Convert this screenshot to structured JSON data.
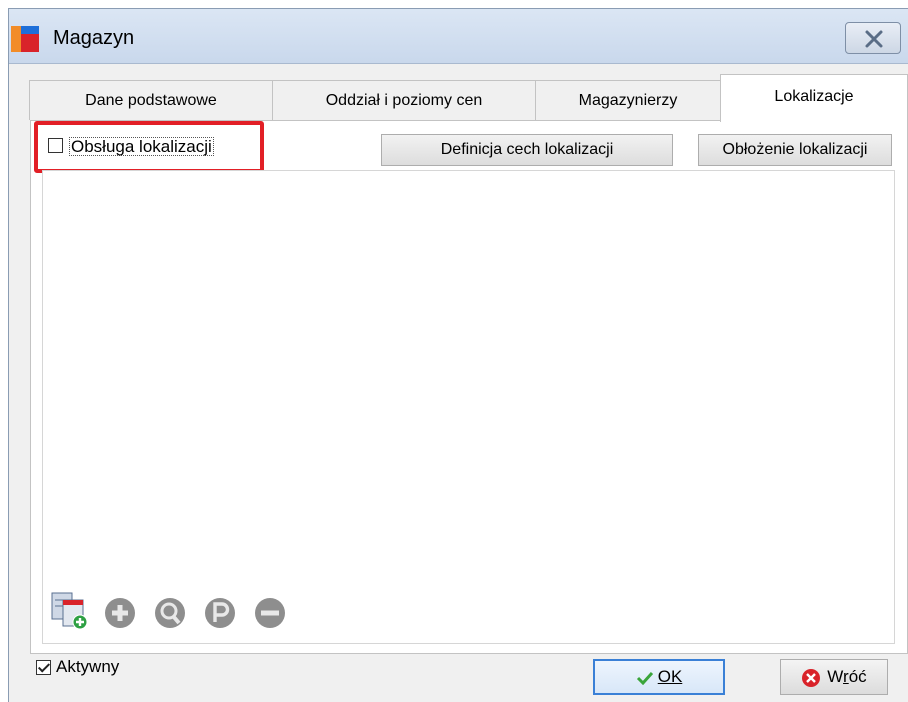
{
  "window": {
    "title": "Magazyn"
  },
  "tabs": [
    {
      "label": "Dane podstawowe"
    },
    {
      "label": "Oddział i poziomy cen"
    },
    {
      "label": "Magazynierzy"
    },
    {
      "label": "Lokalizacje",
      "active": true
    }
  ],
  "lokalizacje": {
    "checkbox_label": "Obsługa lokalizacji",
    "checkbox_checked": false,
    "define_button": "Definicja cech lokalizacji",
    "occupancy_button": "Obłożenie lokalizacji"
  },
  "toolbar": {
    "icons": [
      "add-from-list-icon",
      "add-icon",
      "preview-icon",
      "p-icon",
      "remove-icon"
    ]
  },
  "footer": {
    "active_label": "Aktywny",
    "active_checked": true,
    "ok_label": "OK",
    "back_label_prefix": "W",
    "back_label_underline": "r",
    "back_label_suffix": "óć"
  },
  "colors": {
    "highlight": "#e21f26",
    "ok_border": "#3a80d6",
    "titlebar": "#c9d8ec"
  }
}
